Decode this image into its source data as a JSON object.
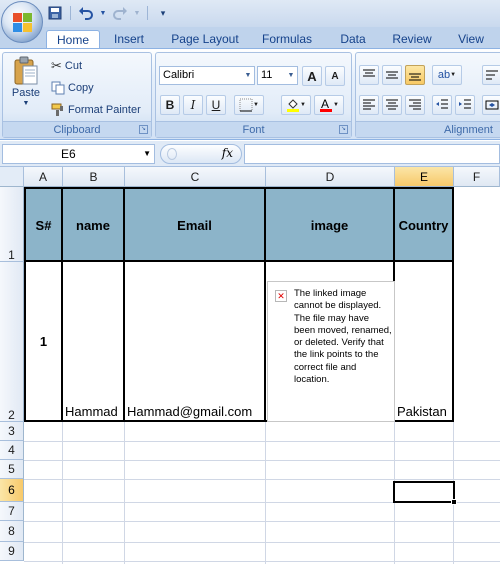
{
  "qat": {
    "save_icon": "save-icon",
    "undo_icon": "undo-icon",
    "redo_icon": "redo-icon",
    "customize_icon": "customize-icon"
  },
  "tabs": [
    {
      "label": "Home",
      "active": true
    },
    {
      "label": "Insert"
    },
    {
      "label": "Page Layout"
    },
    {
      "label": "Formulas"
    },
    {
      "label": "Data"
    },
    {
      "label": "Review"
    },
    {
      "label": "View"
    }
  ],
  "clipboard": {
    "group_label": "Clipboard",
    "paste_label": "Paste",
    "cut_label": "Cut",
    "copy_label": "Copy",
    "format_painter_label": "Format Painter"
  },
  "font": {
    "group_label": "Font",
    "font_name": "Calibri",
    "font_size": "11",
    "bold": "B",
    "italic": "I",
    "underline": "U",
    "grow": "A",
    "shrink": "A"
  },
  "alignment": {
    "group_label": "Alignment"
  },
  "formula_bar": {
    "name_box": "E6",
    "fx": "fx",
    "value": ""
  },
  "columns": [
    "A",
    "B",
    "C",
    "D",
    "E",
    "F"
  ],
  "selected_column": "E",
  "rows": [
    "1",
    "2",
    "3",
    "4",
    "5",
    "6",
    "7",
    "8",
    "9"
  ],
  "selected_row": "6",
  "sheet": {
    "headers": {
      "a": "S#",
      "b": "name",
      "c": "Email",
      "d": "image",
      "e": "Country"
    },
    "row2": {
      "a": "1",
      "b": "Hammad",
      "c": "Hammad@gmail.com",
      "d": "",
      "e": "Pakistan"
    },
    "broken_image_text": "The linked image cannot be displayed. The file may have been moved, renamed, or deleted. Verify that the link points to the correct file and location."
  },
  "colors": {
    "header_fill": "#8cb4c9",
    "selected_header": "#f7c96a",
    "ribbon_bg": "#d3e2f5",
    "tab_text": "#15428b"
  }
}
